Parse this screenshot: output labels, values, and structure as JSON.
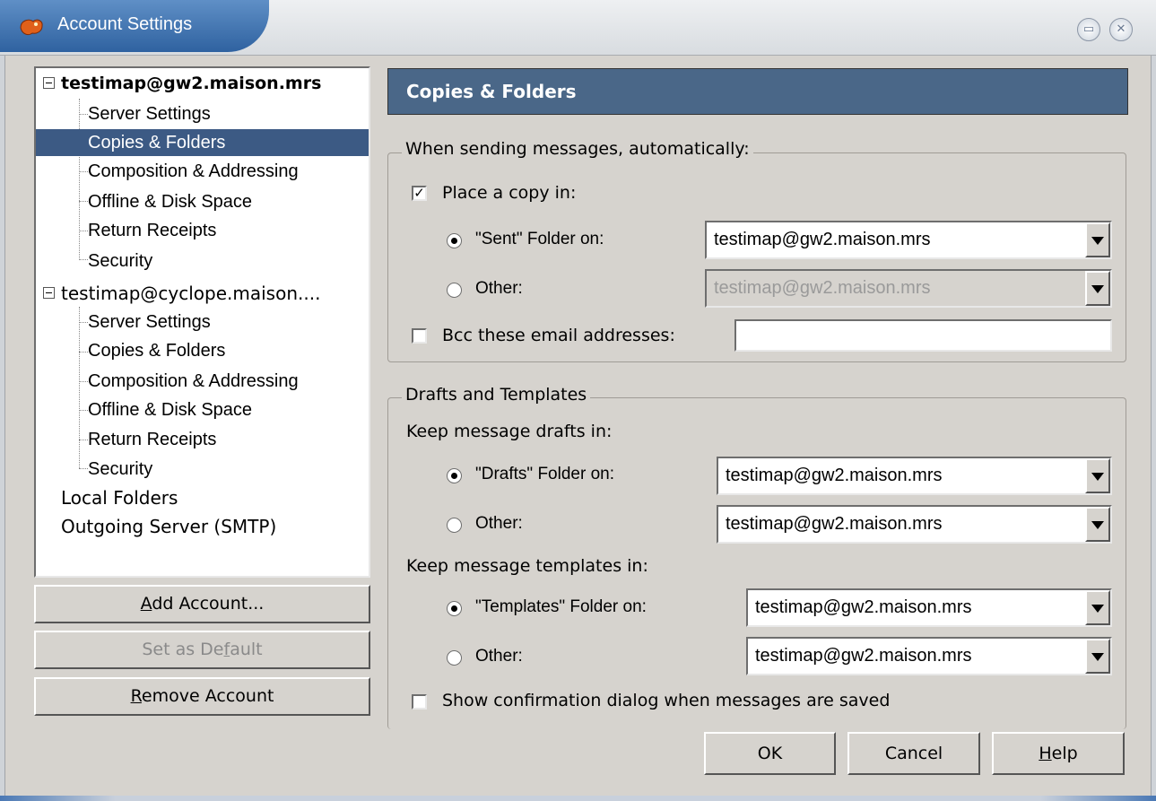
{
  "window": {
    "title": "Account Settings",
    "restore_glyph": "▭",
    "close_glyph": "✕"
  },
  "tree": {
    "expander_glyph": "⊟",
    "accounts": [
      {
        "name": "testimap@gw2.maison.mrs",
        "items": [
          "Server Settings",
          "Copies & Folders",
          "Composition & Addressing",
          "Offline & Disk Space",
          "Return Receipts",
          "Security"
        ]
      },
      {
        "name": "testimap@cyclope.maison....",
        "items": [
          "Server Settings",
          "Copies & Folders",
          "Composition & Addressing",
          "Offline & Disk Space",
          "Return Receipts",
          "Security"
        ]
      }
    ],
    "other_items": [
      "Local Folders",
      "Outgoing Server (SMTP)"
    ],
    "selected": "Copies & Folders"
  },
  "side_buttons": {
    "add_account_prefix": "",
    "add_account_mnemonic": "A",
    "add_account_rest": "dd Account...",
    "set_default_pre": "Set as De",
    "set_default_mnemonic": "f",
    "set_default_post": "ault",
    "remove_account_mnemonic": "R",
    "remove_account_rest": "emove Account"
  },
  "panel": {
    "header": "Copies & Folders",
    "sending": {
      "legend": "When sending messages, automatically:",
      "place_copy_label": "Place a copy in:",
      "place_copy_checked": true,
      "sent_folder_label": "\"Sent\" Folder on:",
      "sent_folder_value": "testimap@gw2.maison.mrs",
      "other_label": "Other:",
      "other_value": "testimap@gw2.maison.mrs",
      "bcc_label": "Bcc these email addresses:",
      "bcc_checked": false,
      "bcc_value": ""
    },
    "drafts": {
      "legend": "Drafts and Templates",
      "keep_drafts_label": "Keep message drafts in:",
      "drafts_folder_label": "\"Drafts\" Folder on:",
      "drafts_folder_value": "testimap@gw2.maison.mrs",
      "drafts_other_label": "Other:",
      "drafts_other_value": "testimap@gw2.maison.mrs",
      "keep_templates_label": "Keep message templates in:",
      "templates_folder_label": "\"Templates\" Folder on:",
      "templates_folder_value": "testimap@gw2.maison.mrs",
      "templates_other_label": "Other:",
      "templates_other_value": "testimap@gw2.maison.mrs",
      "show_confirm_label": "Show confirmation dialog when messages are saved",
      "show_confirm_checked": false
    }
  },
  "dialog_buttons": {
    "ok": "OK",
    "cancel": "Cancel",
    "help_mnemonic": "H",
    "help_rest": "elp"
  },
  "glyphs": {
    "check": "✓"
  }
}
